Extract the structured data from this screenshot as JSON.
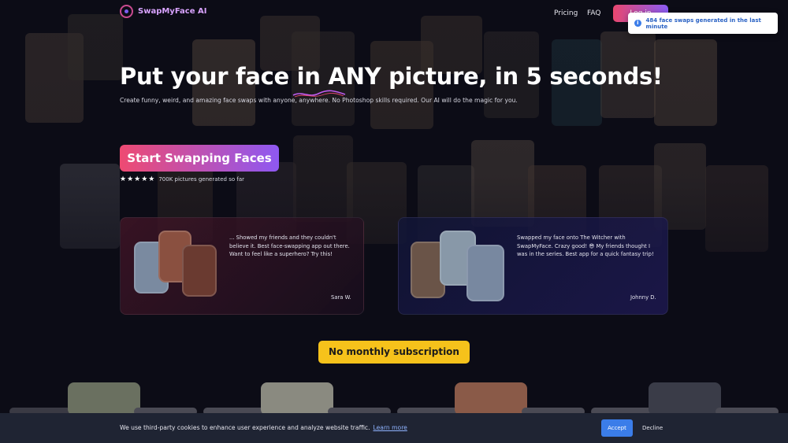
{
  "nav": {
    "brand": "SwapMyFace AI",
    "links": [
      "Pricing",
      "FAQ"
    ],
    "cta_label": "Log in"
  },
  "toast": {
    "icon": "info-icon",
    "text": "484 face swaps generated in the last minute"
  },
  "hero": {
    "title_before": "Put your face in ",
    "title_any": "ANY",
    "title_after": " picture, in 5 seconds!",
    "subtitle": "Create funny, weird, and amazing face swaps with anyone, anywhere. No Photoshop skills required. Our AI will do the magic for you.",
    "cta_label": "Start Swapping Faces",
    "stars": "★★★★★",
    "rating_text": "700K pictures generated so far"
  },
  "testimonials": [
    {
      "quote": "... Showed my friends and they couldn't believe it. Best face-swapping app out there. Want to feel like a superhero? Try this!",
      "author": "Sara W."
    },
    {
      "quote": "Swapped my face onto The Witcher with SwapMyFace. Crazy good! 😎 My friends thought I was in the series. Best app for a quick fantasy trip!",
      "author": "Johnny D."
    }
  ],
  "no_subscription_label": "No monthly subscription",
  "cookie": {
    "text": "We use third-party cookies to enhance user experience and analyze website traffic.",
    "link": "Learn more",
    "accept": "Accept",
    "decline": "Decline"
  },
  "colors": {
    "background": "#0c0c16",
    "brand_gradient_start": "#ee4a72",
    "brand_gradient_end": "#8e58f2",
    "highlight_yellow": "#f6c21b",
    "accept_blue": "#3b7de9"
  }
}
